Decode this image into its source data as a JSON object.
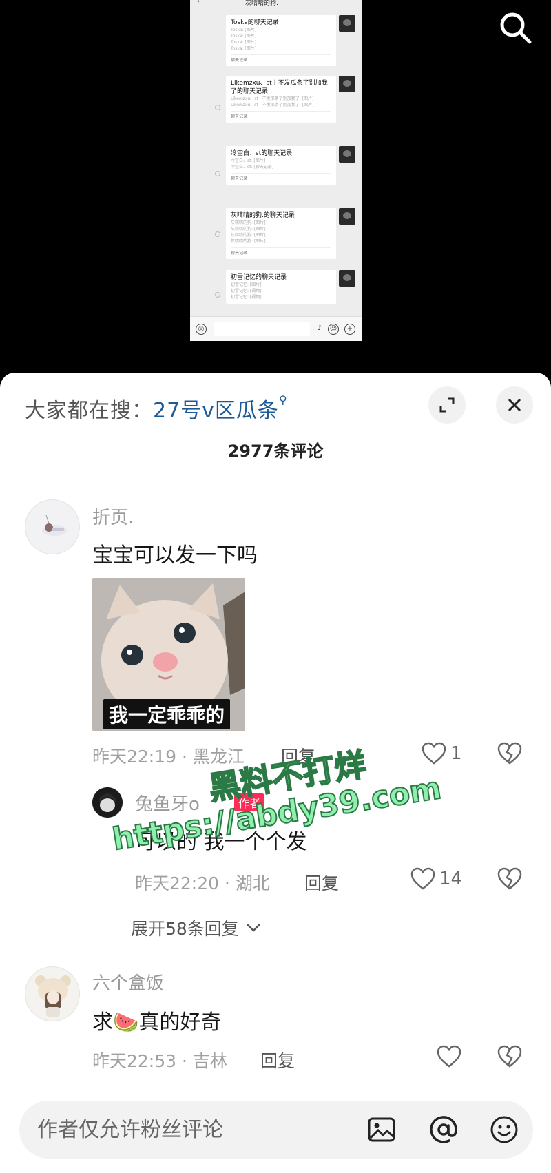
{
  "video": {
    "phone": {
      "title": "灰晴晴的狗.",
      "records": [
        {
          "title": "Toska的聊天记录",
          "lines": [
            "Toska: [图片]",
            "Toska: [图片]",
            "Toska: [图片]",
            "Toska: [图片]"
          ],
          "footer": "聊天记录"
        },
        {
          "title": "Likemzxu、st丨不发瓜条了别加我了的聊天记录",
          "lines": [
            "Likemzxu、st丨不发瓜条了别加我了: [图片]",
            "Likemzxu、st丨不发瓜条了别加我了: [图片]"
          ],
          "footer": "聊天记录"
        },
        {
          "title": "冷空白、st的聊天记录",
          "lines": [
            "冷空白、st: [图片]",
            "冷空白、st: [聊天记录]"
          ],
          "footer": "聊天记录"
        },
        {
          "title": "灰晴晴的狗.的聊天记录",
          "lines": [
            "灰晴晴的狗: [图片]",
            "灰晴晴的狗: [图片]",
            "灰晴晴的狗: [图片]",
            "灰晴晴的狗: [图片]"
          ],
          "footer": "聊天记录"
        },
        {
          "title": "初雪记忆的聊天记录",
          "lines": [
            "初雪记忆: [图片]",
            "初雪记忆: [视频]",
            "初雪记忆: [视频]"
          ],
          "footer": ""
        }
      ]
    }
  },
  "panel": {
    "trending_prefix": "大家都在搜：",
    "trending_keyword": "27号v区瓜条",
    "comment_count": "2977条评论"
  },
  "comments": [
    {
      "name": "折页.",
      "text": "宝宝可以发一下吗",
      "sticker_caption": "我一定乖乖的",
      "meta": "昨天22:19 · 黑龙江",
      "reply": "回复",
      "likes": "1"
    },
    {
      "name": "兔鱼牙o",
      "author_tag": "作者",
      "text": "可以的 我一个个发",
      "meta": "昨天22:20 · 湖北",
      "reply": "回复",
      "likes": "14"
    },
    {
      "name": "六个盒饭",
      "text_before": "求",
      "emoji": "🍉",
      "text_after": "真的好奇",
      "meta": "昨天22:53 · 吉林",
      "reply": "回复",
      "likes": ""
    }
  ],
  "expand_replies": "展开58条回复",
  "watermark": {
    "line1": "黑料不打烊",
    "line2": "https://abdy39.com"
  },
  "input": {
    "placeholder": "作者仅允许粉丝评论"
  },
  "icons": {
    "search": "search-icon",
    "expand": "expand-icon",
    "close": "close-icon",
    "like": "heart-icon",
    "dislike": "broken-heart-icon",
    "image": "image-icon",
    "mention": "at-icon",
    "emoji": "smile-icon"
  }
}
